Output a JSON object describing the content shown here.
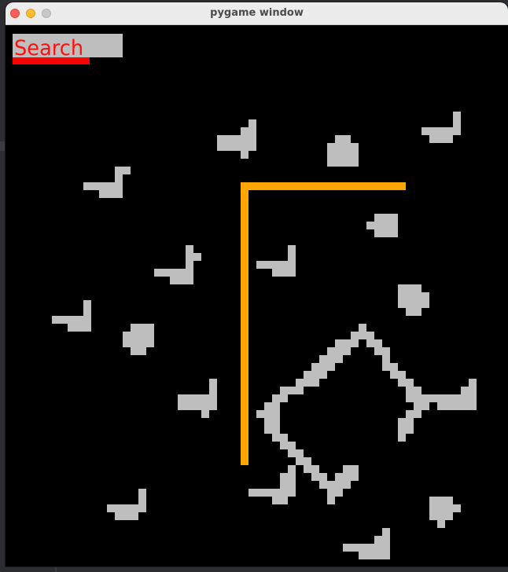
{
  "window": {
    "title": "pygame window"
  },
  "controls": {
    "search_label": "Search"
  },
  "colors": {
    "background": "#000000",
    "obstacle": "#bebebe",
    "path": "#ffa500",
    "button_text": "#ff1010",
    "button_bg": "#bebebe",
    "underline": "#ff0000"
  },
  "icons": {
    "close": "close-window-icon",
    "minimize": "minimize-window-icon",
    "maximize": "maximize-window-icon"
  }
}
